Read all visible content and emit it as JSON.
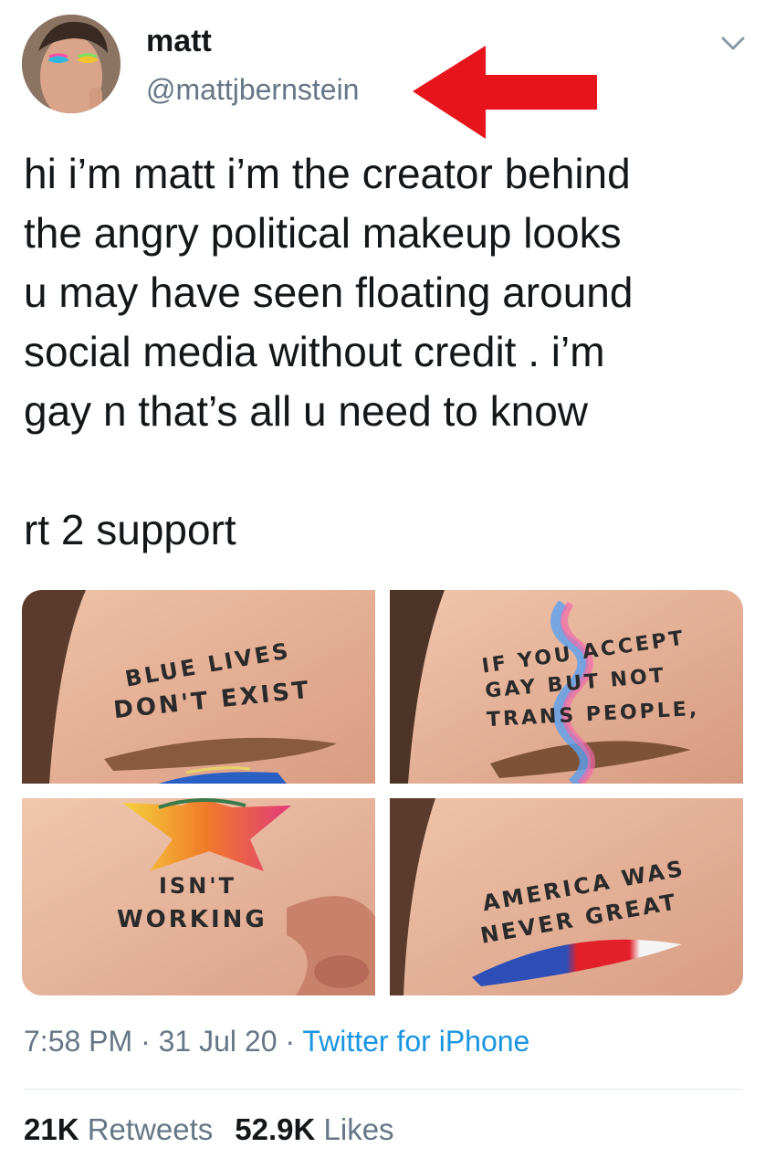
{
  "tweet": {
    "author_name": "matt",
    "author_handle": "@mattjbernstein",
    "text_lines": [
      "hi i’m matt i’m the creator behind",
      "the angry political makeup looks",
      "u may have seen floating around",
      "social media without credit . i’m",
      "gay n that’s all u need to know",
      "",
      "rt 2 support"
    ],
    "time": "7:58 PM",
    "date": "31 Jul 20",
    "source": "Twitter for iPhone",
    "separator": "·",
    "retweets_count": "21K",
    "retweets_label": "Retweets",
    "likes_count": "52.9K",
    "likes_label": "Likes"
  },
  "media": {
    "panels": [
      {
        "lines": [
          "BLUE LIVES",
          "DON'T EXIST"
        ]
      },
      {
        "lines": [
          "IF YOU ACCEPT",
          "GAY BUT NOT",
          "TRANS PEOPLE,"
        ]
      },
      {
        "lines": [
          "ISN'T",
          "WORKING"
        ]
      },
      {
        "lines": [
          "AMERICA WAS",
          "NEVER GREAT"
        ]
      }
    ]
  },
  "icons": {
    "chevron": "chevron-down-icon",
    "annotation": "red-arrow-left"
  },
  "colors": {
    "handle": "#657786",
    "link": "#1b95e0",
    "arrow": "#e8141c",
    "divider": "#e1e8ed",
    "skin": "#e9b9a0"
  }
}
